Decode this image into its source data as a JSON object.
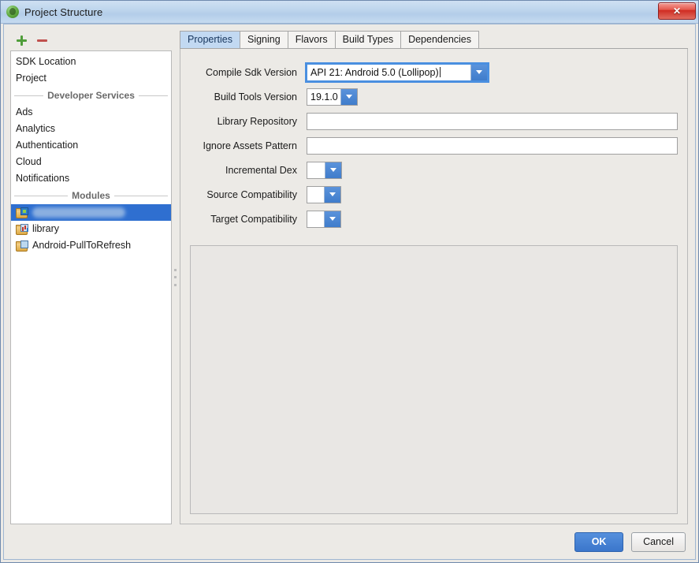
{
  "window": {
    "title": "Project Structure",
    "icon": "android-studio-icon",
    "close_label": "✕"
  },
  "sidebar": {
    "toolbar": {
      "add_label": "+",
      "remove_label": "−"
    },
    "top_items": [
      {
        "label": "SDK Location"
      },
      {
        "label": "Project"
      }
    ],
    "groups": [
      {
        "title": "Developer Services",
        "items": [
          {
            "label": "Ads"
          },
          {
            "label": "Analytics"
          },
          {
            "label": "Authentication"
          },
          {
            "label": "Cloud"
          },
          {
            "label": "Notifications"
          }
        ]
      },
      {
        "title": "Modules",
        "items": [
          {
            "label": "",
            "redacted": true,
            "selected": true,
            "icon": "module-app-icon"
          },
          {
            "label": "library",
            "redacted": false,
            "selected": false,
            "icon": "module-library-icon"
          },
          {
            "label": "Android-PullToRefresh",
            "redacted": false,
            "selected": false,
            "icon": "module-folder-icon"
          }
        ]
      }
    ]
  },
  "main": {
    "tabs": [
      {
        "label": "Properties",
        "active": true
      },
      {
        "label": "Signing",
        "active": false
      },
      {
        "label": "Flavors",
        "active": false
      },
      {
        "label": "Build Types",
        "active": false
      },
      {
        "label": "Dependencies",
        "active": false
      }
    ],
    "fields": [
      {
        "label": "Compile Sdk Version",
        "value": "API 21: Android 5.0 (Lollipop)",
        "type": "combo",
        "focused": true
      },
      {
        "label": "Build Tools Version",
        "value": "19.1.0",
        "type": "combo",
        "focused": false
      },
      {
        "label": "Library Repository",
        "value": "",
        "type": "text",
        "focused": false
      },
      {
        "label": "Ignore Assets Pattern",
        "value": "",
        "type": "text",
        "focused": false
      },
      {
        "label": "Incremental Dex",
        "value": "",
        "type": "combo",
        "focused": false
      },
      {
        "label": "Source Compatibility",
        "value": "",
        "type": "combo",
        "focused": false
      },
      {
        "label": "Target Compatibility",
        "value": "",
        "type": "combo",
        "focused": false
      }
    ]
  },
  "footer": {
    "ok_label": "OK",
    "cancel_label": "Cancel"
  },
  "colors": {
    "selection_blue": "#2f6fd0",
    "tab_active": "#c2d9f2",
    "titlebar": "#b8d0ea",
    "primary_button": "#3b76cb",
    "close_red": "#cf2b22",
    "add_green": "#4f9d3a",
    "remove_red": "#c0504d"
  }
}
